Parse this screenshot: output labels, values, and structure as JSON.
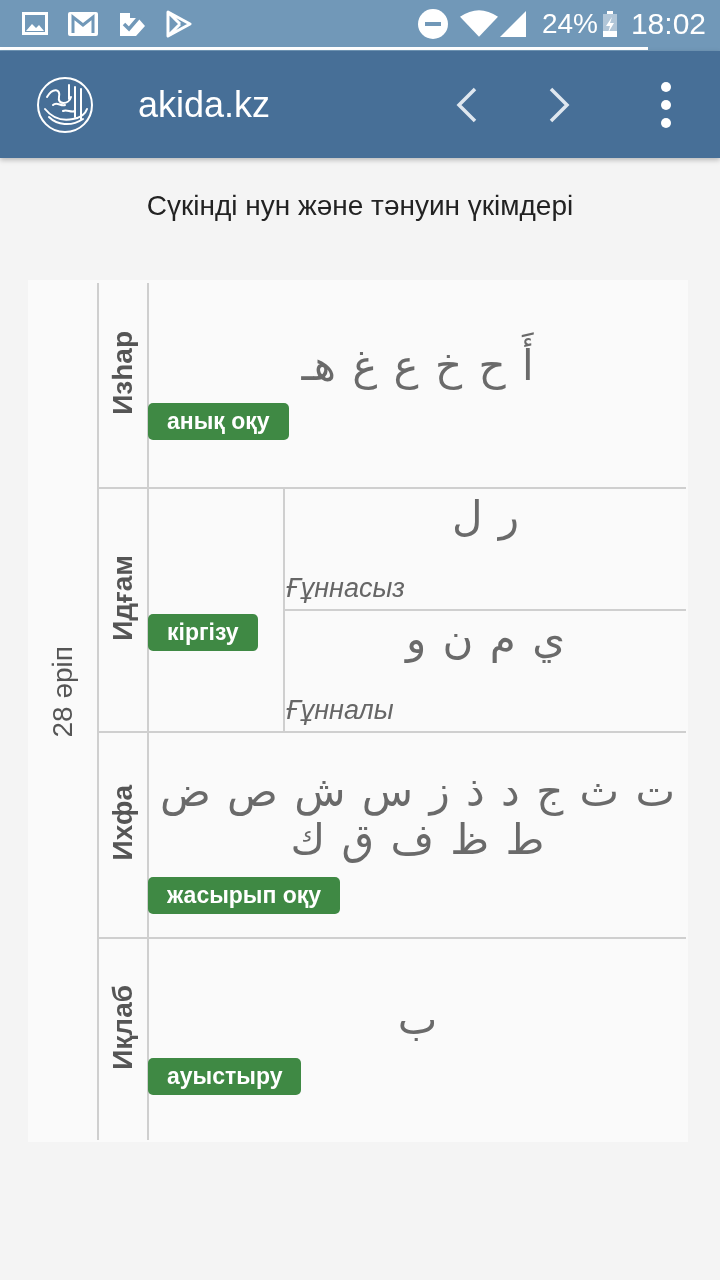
{
  "status_bar": {
    "battery": "24%",
    "time": "18:02"
  },
  "progress_bar": {
    "level": 0.9
  },
  "app_bar": {
    "title": "akida.kz"
  },
  "page": {
    "heading": "Сүкінді нун және тәнуин үкімдері",
    "table": {
      "side_label": "28 әріп",
      "rows": [
        {
          "kind": "single",
          "name": "Изһар",
          "letters": "أَ ح خ ع غ هـ",
          "badge": "анық оқу"
        },
        {
          "kind": "split",
          "name": "Идғам",
          "badge": "кіргізу",
          "parts": [
            {
              "letters": "ر ل",
              "label": "Ғұннасыз"
            },
            {
              "letters": "ي م ن و",
              "label": "Ғұнналы"
            }
          ]
        },
        {
          "kind": "single",
          "name": "Ихфа",
          "letters": "ت ث ج د ذ ز س ش ص ض ط ظ ف ق ك",
          "badge": "жасырып оқу"
        },
        {
          "kind": "single",
          "name": "Иқлаб",
          "letters": "ب",
          "badge": "ауыстыру"
        }
      ]
    }
  }
}
